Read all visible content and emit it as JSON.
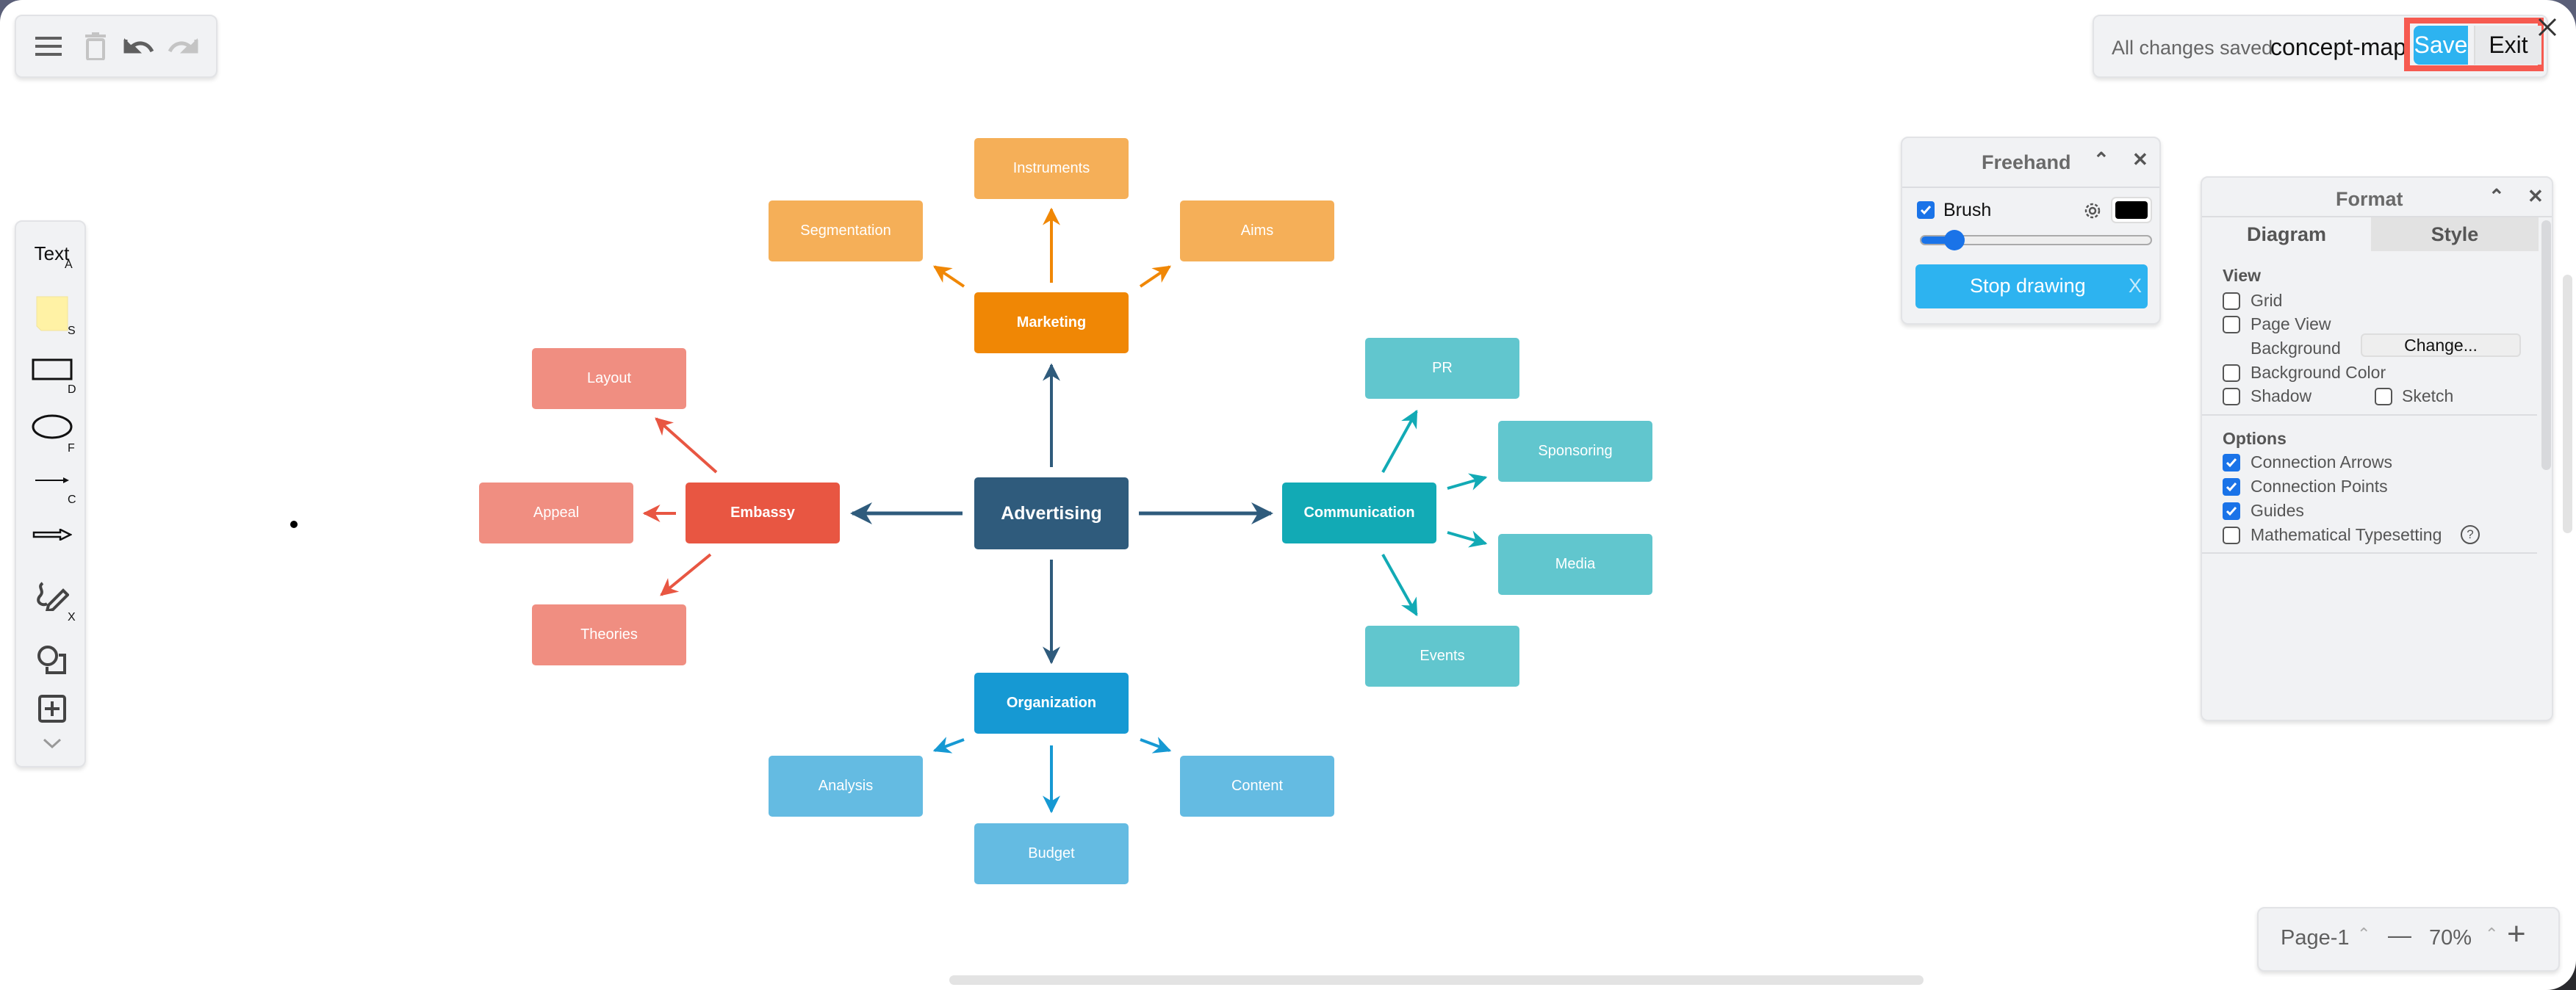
{
  "toolbar": {
    "menu_icon": "hamburger-menu-icon",
    "delete_icon": "trash-icon",
    "undo_icon": "undo-icon",
    "redo_icon": "redo-icon"
  },
  "header": {
    "save_status": "All changes saved",
    "file_name": "concept-map",
    "save_label": "Save",
    "exit_label": "Exit",
    "close_glyph": "✕"
  },
  "left_toolbar": {
    "items": [
      {
        "label": "Text",
        "shortcut": "A"
      },
      {
        "label": "Sticky Note",
        "shortcut": "S"
      },
      {
        "label": "Rectangle",
        "shortcut": "D"
      },
      {
        "label": "Ellipse",
        "shortcut": "F"
      },
      {
        "label": "Line",
        "shortcut": "C"
      },
      {
        "label": "Arrow",
        "shortcut": ""
      },
      {
        "label": "Freehand",
        "shortcut": "X"
      },
      {
        "label": "Shapes",
        "shortcut": ""
      },
      {
        "label": "Insert",
        "shortcut": ""
      },
      {
        "label": "More",
        "shortcut": ""
      }
    ]
  },
  "freehand": {
    "title": "Freehand",
    "brush_label": "Brush",
    "brush_checked": true,
    "brush_color": "#000000",
    "brush_size_fraction": 0.1,
    "stop_label": "Stop drawing",
    "stop_close": "X"
  },
  "format": {
    "title": "Format",
    "tabs": [
      "Diagram",
      "Style"
    ],
    "active_tab": "Diagram",
    "view_heading": "View",
    "grid": {
      "label": "Grid",
      "checked": false
    },
    "page_view": {
      "label": "Page View",
      "checked": false
    },
    "background_label": "Background",
    "change_label": "Change...",
    "background_color": {
      "label": "Background Color",
      "checked": false
    },
    "shadow": {
      "label": "Shadow",
      "checked": false
    },
    "sketch": {
      "label": "Sketch",
      "checked": false
    },
    "options_heading": "Options",
    "connection_arrows": {
      "label": "Connection Arrows",
      "checked": true
    },
    "connection_points": {
      "label": "Connection Points",
      "checked": true
    },
    "guides": {
      "label": "Guides",
      "checked": true
    },
    "math": {
      "label": "Mathematical Typesetting",
      "checked": false
    },
    "help_glyph": "?"
  },
  "page_control": {
    "page_name": "Page-1",
    "zoom": "70%",
    "zoom_out": "—",
    "zoom_in": "+"
  },
  "diagram": {
    "colors": {
      "advertising": "#2f5b7c",
      "marketing": "#f08705",
      "marketing_light": "#f5af58",
      "embassy": "#e85642",
      "embassy_light": "#f08e81",
      "communication": "#12aab5",
      "communication_light": "#61c6ce",
      "organization": "#1699d3",
      "organization_light": "#64bbe2"
    },
    "nodes": {
      "advertising": "Advertising",
      "marketing": "Marketing",
      "instruments": "Instruments",
      "segmentation": "Segmentation",
      "aims": "Aims",
      "embassy": "Embassy",
      "layout": "Layout",
      "appeal": "Appeal",
      "theories": "Theories",
      "communication": "Communication",
      "pr": "PR",
      "sponsoring": "Sponsoring",
      "media": "Media",
      "events": "Events",
      "organization": "Organization",
      "analysis": "Analysis",
      "content": "Content",
      "budget": "Budget"
    }
  }
}
